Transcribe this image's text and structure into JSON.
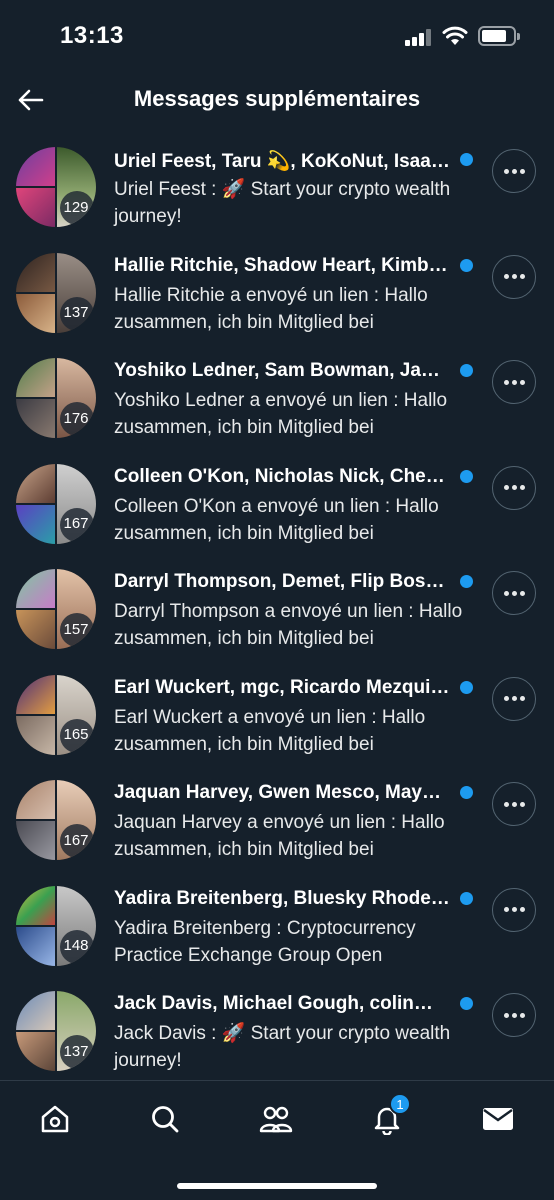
{
  "status": {
    "time": "13:13"
  },
  "header": {
    "title": "Messages supplémentaires"
  },
  "rows": [
    {
      "title": "Uriel Feest, Taru 💫, KoKoNut, Isaac…",
      "preview": "Uriel Feest : 🚀 Start your crypto wealth journey!",
      "count": "129"
    },
    {
      "title": "Hallie Ritchie, Shadow Heart, Kimberly…",
      "preview": "Hallie Ritchie a envoyé un lien : Hallo zusammen, ich bin Mitglied bei",
      "count": "137"
    },
    {
      "title": "Yoshiko Ledner, Sam Bowman, Jason…",
      "preview": "Yoshiko Ledner a envoyé un lien : Hallo zusammen, ich bin Mitglied bei",
      "count": "176"
    },
    {
      "title": "Colleen O'Kon, Nicholas Nick, Cheryl…",
      "preview": "Colleen O'Kon a envoyé un lien : Hallo zusammen, ich bin Mitglied bei",
      "count": "167"
    },
    {
      "title": "Darryl Thompson, Demet, Flip Boss…",
      "preview": "Darryl Thompson a envoyé un lien : Hallo zusammen, ich bin Mitglied bei",
      "count": "157"
    },
    {
      "title": "Earl Wuckert, mgc, Ricardo Mezquita…",
      "preview": "Earl Wuckert a envoyé un lien : Hallo zusammen, ich bin Mitglied bei",
      "count": "165"
    },
    {
      "title": "Jaquan Harvey, Gwen Mesco, Maya…",
      "preview": "Jaquan Harvey a envoyé un lien : Hallo zusammen, ich bin Mitglied bei",
      "count": "167"
    },
    {
      "title": "Yadira Breitenberg, Bluesky Rhodes…",
      "preview": "Yadira Breitenberg : Cryptocurrency Practice Exchange Group Open",
      "count": "148"
    },
    {
      "title": "Jack Davis, Michael Gough, colin…",
      "preview": "Jack Davis : 🚀 Start your crypto wealth journey!",
      "count": "137"
    }
  ],
  "tabbar": {
    "notifications_badge": "1"
  },
  "colors": {
    "background": "#15202b",
    "accent": "#1d9bf0",
    "border": "#536471"
  }
}
